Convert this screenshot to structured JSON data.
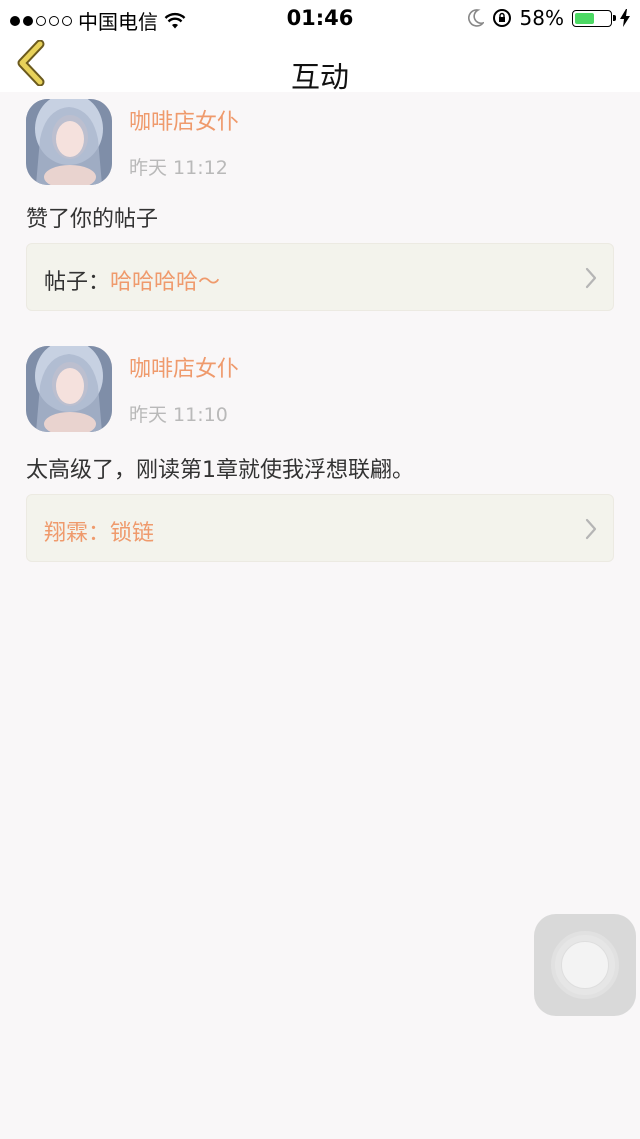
{
  "status_bar": {
    "carrier": "中国电信",
    "time": "01:46",
    "battery": "58%",
    "battery_level": 0.58,
    "icons": [
      "signal-dots-icon",
      "wifi-icon",
      "moon-icon",
      "orientation-lock-icon",
      "battery-icon",
      "charging-icon"
    ]
  },
  "nav": {
    "title": "互动",
    "back_icon": "chevron-left-icon",
    "accent_color": "#e8d25a"
  },
  "feed": {
    "items": [
      {
        "username": "咖啡店女仆",
        "time": "昨天 11:12",
        "content": "赞了你的帖子",
        "ref_prefix": "帖子：",
        "ref_title": "哈哈哈哈～"
      },
      {
        "username": "咖啡店女仆",
        "time": "昨天 11:10",
        "content": "太高级了，刚读第1章就使我浮想联翩。",
        "ref_prefix": "翔霖：",
        "ref_title": "锁链"
      }
    ]
  },
  "colors": {
    "username": "#ef9a6c",
    "timestamp": "#b9b9b9",
    "background": "#f9f7f8",
    "card": "#f3f3ec"
  }
}
